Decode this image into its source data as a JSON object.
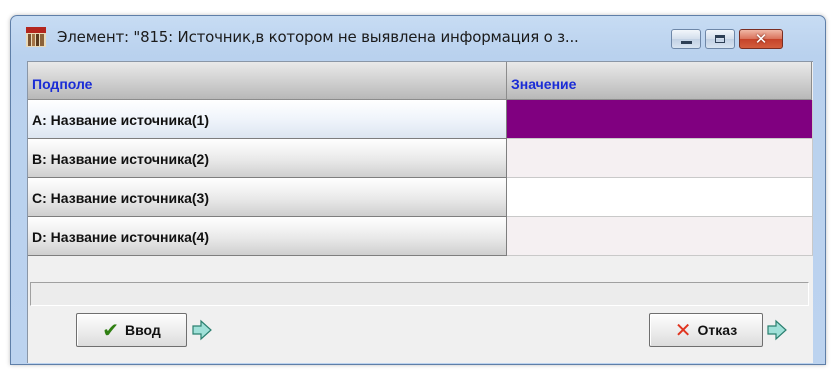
{
  "window": {
    "title": "Элемент: \"815: Источник,в котором не выявлена информация о з...",
    "app_icon": "irbis-books-icon",
    "controls": {
      "minimize": "minimize-icon",
      "maximize": "maximize-icon",
      "close": "✕"
    }
  },
  "grid": {
    "headers": {
      "subfield": "Подполе",
      "value": "Значение"
    },
    "rows": [
      {
        "label": "A: Название источника(1)",
        "value": "",
        "value_bg": "#800080",
        "selected": true
      },
      {
        "label": "B: Название источника(2)",
        "value": "",
        "value_bg": "#f5f0f2",
        "selected": false
      },
      {
        "label": "C: Название источника(3)",
        "value": "",
        "value_bg": "#ffffff",
        "selected": false
      },
      {
        "label": "D: Название источника(4)",
        "value": "",
        "value_bg": "#f5f0f2",
        "selected": false
      }
    ]
  },
  "status_text": "",
  "buttons": {
    "ok": {
      "label": "Ввод",
      "icon": "check-icon"
    },
    "cancel": {
      "label": "Отказ",
      "icon": "cross-icon"
    }
  },
  "colors": {
    "header_text": "#1a2cd6",
    "selected_cell": "#800080",
    "arrow": "#9fe0d8"
  }
}
